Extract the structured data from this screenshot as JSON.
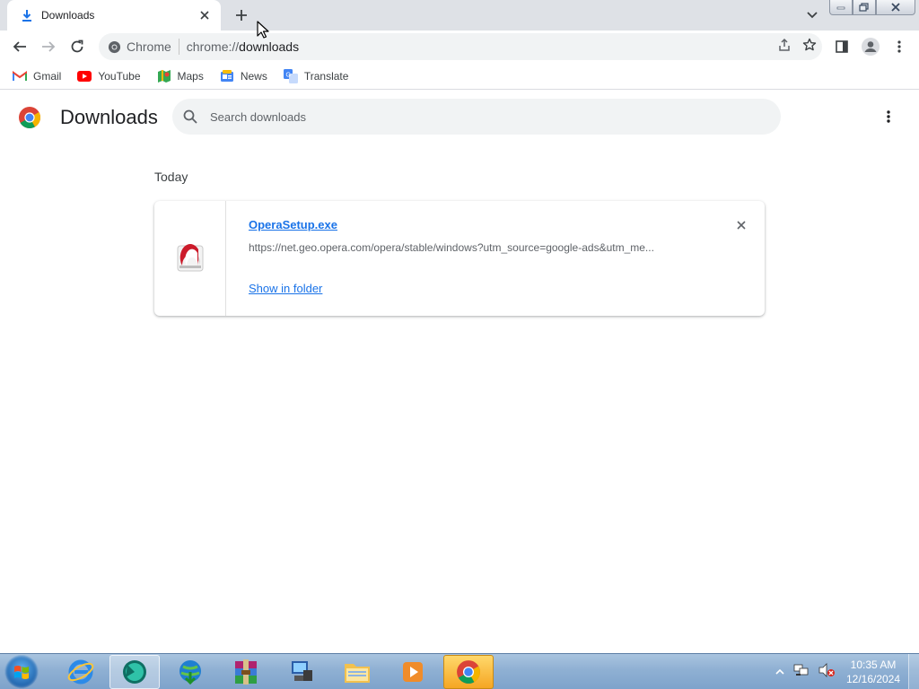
{
  "tab": {
    "title": "Downloads",
    "close_symbol": "✕"
  },
  "omnibox": {
    "chip_label": "Chrome",
    "url_scheme": "chrome://",
    "url_host": "downloads"
  },
  "bookmarks": [
    {
      "label": "Gmail",
      "icon": "gmail-icon"
    },
    {
      "label": "YouTube",
      "icon": "youtube-icon"
    },
    {
      "label": "Maps",
      "icon": "maps-icon"
    },
    {
      "label": "News",
      "icon": "news-icon"
    },
    {
      "label": "Translate",
      "icon": "translate-icon"
    }
  ],
  "downloads_page": {
    "title": "Downloads",
    "search_placeholder": "Search downloads",
    "section_label": "Today",
    "items": [
      {
        "file_name": "OperaSetup.exe",
        "url": "https://net.geo.opera.com/opera/stable/windows?utm_source=google-ads&utm_me...",
        "action_label": "Show in folder"
      }
    ]
  },
  "taskbar": {
    "time": "10:35 AM",
    "date": "12/16/2024"
  },
  "colors": {
    "accent": "#1a73e8",
    "tabstrip": "#dee1e6",
    "omnibox": "#f1f3f4",
    "taskbar": "#8fb0d3"
  }
}
